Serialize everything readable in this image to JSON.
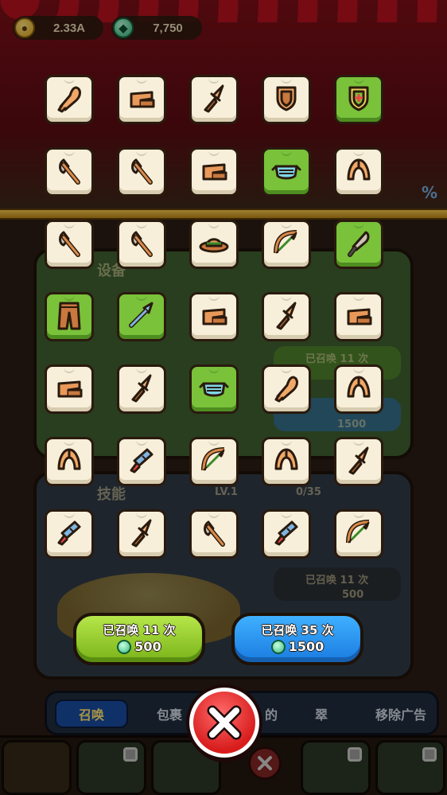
{
  "currency": {
    "gold": "2.33A",
    "gems": "7,750"
  },
  "background": {
    "panel_equipment_title": "设备",
    "panel_skill_title": "技能",
    "skill_level": "LV.1",
    "skill_progress": "0/35",
    "summoned_11": "已召唤 11 次",
    "cost_1500": "1500",
    "cost_500": "500"
  },
  "items": [
    {
      "icon": "club-icon",
      "rare": false
    },
    {
      "icon": "brick-icon",
      "rare": false
    },
    {
      "icon": "dagger-icon",
      "rare": false
    },
    {
      "icon": "shield-icon",
      "rare": false
    },
    {
      "icon": "shield-plus-icon",
      "rare": true
    },
    {
      "icon": "axe-icon",
      "rare": false
    },
    {
      "icon": "axe-icon",
      "rare": false
    },
    {
      "icon": "brick-icon",
      "rare": false
    },
    {
      "icon": "mask-icon",
      "rare": true
    },
    {
      "icon": "helmet-icon",
      "rare": false
    },
    {
      "icon": "axe-icon",
      "rare": false
    },
    {
      "icon": "axe-icon",
      "rare": false
    },
    {
      "icon": "hat-icon",
      "rare": false
    },
    {
      "icon": "bow-icon",
      "rare": false
    },
    {
      "icon": "knife-icon",
      "rare": true
    },
    {
      "icon": "pants-icon",
      "rare": true
    },
    {
      "icon": "spear-icon",
      "rare": true
    },
    {
      "icon": "brick-icon",
      "rare": false
    },
    {
      "icon": "dagger-icon",
      "rare": false
    },
    {
      "icon": "brick-icon",
      "rare": false
    },
    {
      "icon": "brick-icon",
      "rare": false
    },
    {
      "icon": "dagger-icon",
      "rare": false
    },
    {
      "icon": "mask-icon",
      "rare": true
    },
    {
      "icon": "club-icon",
      "rare": false
    },
    {
      "icon": "helmet-icon",
      "rare": false
    },
    {
      "icon": "helmet-icon",
      "rare": false
    },
    {
      "icon": "blaster-icon",
      "rare": false
    },
    {
      "icon": "bow-icon",
      "rare": false
    },
    {
      "icon": "helmet-icon",
      "rare": false
    },
    {
      "icon": "dagger-icon",
      "rare": false
    },
    {
      "icon": "blaster-icon",
      "rare": false
    },
    {
      "icon": "dagger-icon",
      "rare": false
    },
    {
      "icon": "axe-icon",
      "rare": false
    },
    {
      "icon": "blaster-icon",
      "rare": false
    },
    {
      "icon": "bow-icon",
      "rare": false
    }
  ],
  "summon": {
    "green": {
      "label": "已召唤 11 次",
      "cost": "500"
    },
    "blue": {
      "label": "已召唤 35 次",
      "cost": "1500"
    }
  },
  "nav": {
    "tabs": [
      "召唤",
      "包裹",
      "的",
      "翠",
      "移除广告"
    ]
  }
}
